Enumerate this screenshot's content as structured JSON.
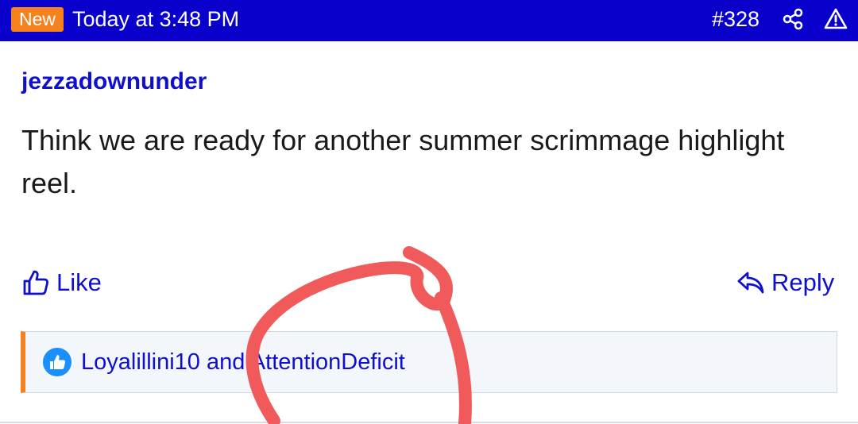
{
  "header": {
    "badge": "New",
    "timestamp": "Today at 3:48 PM",
    "post_number": "#328",
    "share_icon": "share-icon",
    "report_icon": "warning-icon",
    "background_color": "#0a00cc",
    "badge_color": "#f5821f"
  },
  "post": {
    "username": "jezzadownunder",
    "text": "Think we are ready for another summer scrimmage highlight reel."
  },
  "actions": {
    "like_label": "Like",
    "reply_label": "Reply"
  },
  "reactions": {
    "text": "Loyalillini10 and AttentionDeficit",
    "icon": "thumbs-up-icon"
  },
  "annotation": {
    "color": "#f05a5a"
  }
}
